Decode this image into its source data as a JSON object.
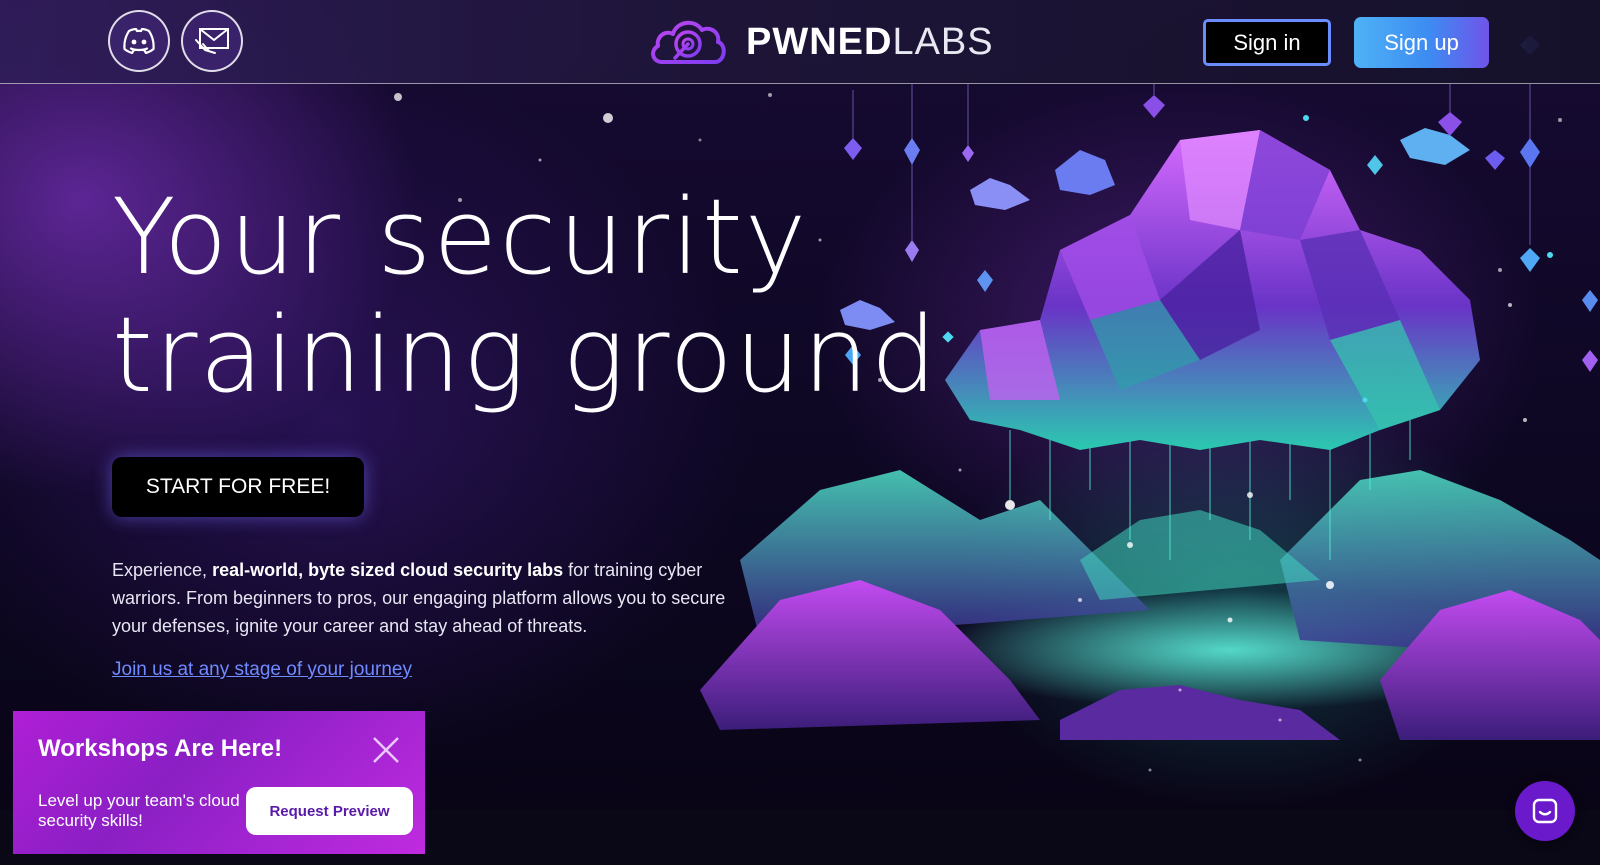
{
  "header": {
    "social": [
      {
        "name": "discord",
        "icon": "discord-icon"
      },
      {
        "name": "email",
        "icon": "mail-icon"
      }
    ],
    "logo": {
      "icon": "cloud-target-icon",
      "text_bold": "PWNED",
      "text_light": "LABS"
    },
    "sign_in_label": "Sign in",
    "sign_up_label": "Sign up"
  },
  "hero": {
    "title_line1": "Your security",
    "title_line2": "training ground",
    "cta_label": "START FOR FREE!",
    "description_prefix": "Experience, ",
    "description_bold": "real-world, byte sized cloud security labs",
    "description_suffix": " for training cyber warriors. From beginners to pros, our engaging platform allows you to secure your defenses, ignite your career and stay ahead of threats.",
    "journey_link": "Join us at any stage of your journey"
  },
  "promo": {
    "title": "Workshops Are Here!",
    "text": "Level up your team's cloud security skills!",
    "button_label": "Request Preview",
    "close_icon": "close-icon"
  },
  "chat": {
    "icon": "chat-icon"
  },
  "colors": {
    "accent_blue": "#4fb2f5",
    "accent_purple": "#b042e0",
    "promo_magenta": "#b01fd6",
    "link": "#6f8bff"
  }
}
